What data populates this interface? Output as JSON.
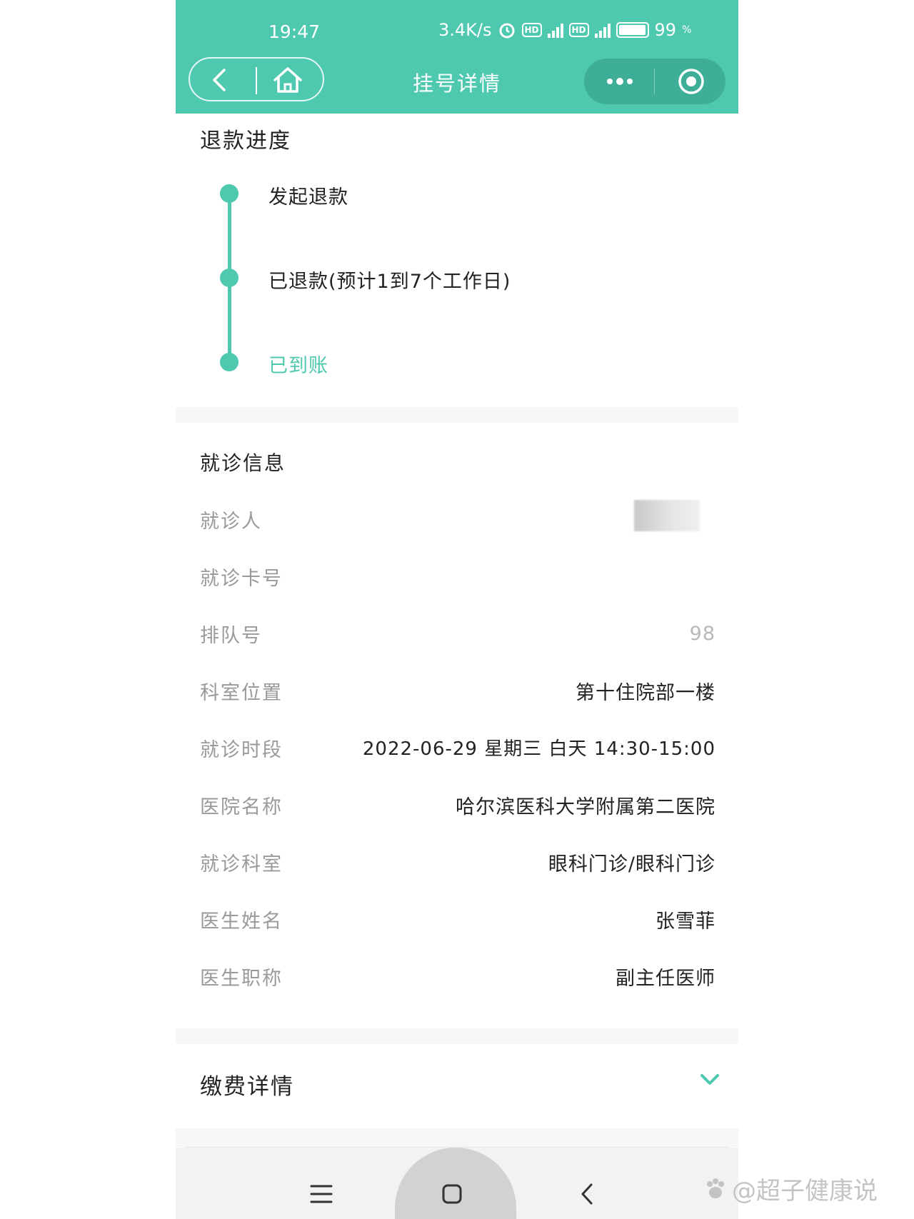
{
  "status_bar": {
    "time": "19:47",
    "speed": "3.4K/s",
    "hd1": "HD",
    "hd2": "HD",
    "battery": "99"
  },
  "nav": {
    "title": "挂号详情",
    "icons": [
      "back-icon",
      "home-icon",
      "more-icon",
      "target-icon"
    ]
  },
  "refund": {
    "title": "退款进度",
    "steps": [
      {
        "label": "发起退款"
      },
      {
        "label": "已退款(预计1到7个工作日)"
      },
      {
        "label": "已到账"
      }
    ]
  },
  "visit": {
    "title": "就诊信息",
    "rows": [
      {
        "label": "就诊人",
        "value": ""
      },
      {
        "label": "就诊卡号",
        "value": ""
      },
      {
        "label": "排队号",
        "value": "98"
      },
      {
        "label": "科室位置",
        "value": "第十住院部一楼"
      },
      {
        "label": "就诊时段",
        "value": "2022-06-29 星期三 白天 14:30-15:00"
      },
      {
        "label": "医院名称",
        "value": "哈尔滨医科大学附属第二医院"
      },
      {
        "label": "就诊科室",
        "value": "眼科门诊/眼科门诊"
      },
      {
        "label": "医生姓名",
        "value": "张雪菲"
      },
      {
        "label": "医生职称",
        "value": "副主任医师"
      }
    ]
  },
  "payment": {
    "title": "缴费详情"
  },
  "watermark": "@超子健康说",
  "colors": {
    "accent": "#4fc8b0",
    "accent_dark": "#3fae99",
    "label": "#9a9a9a",
    "text": "#222222"
  }
}
